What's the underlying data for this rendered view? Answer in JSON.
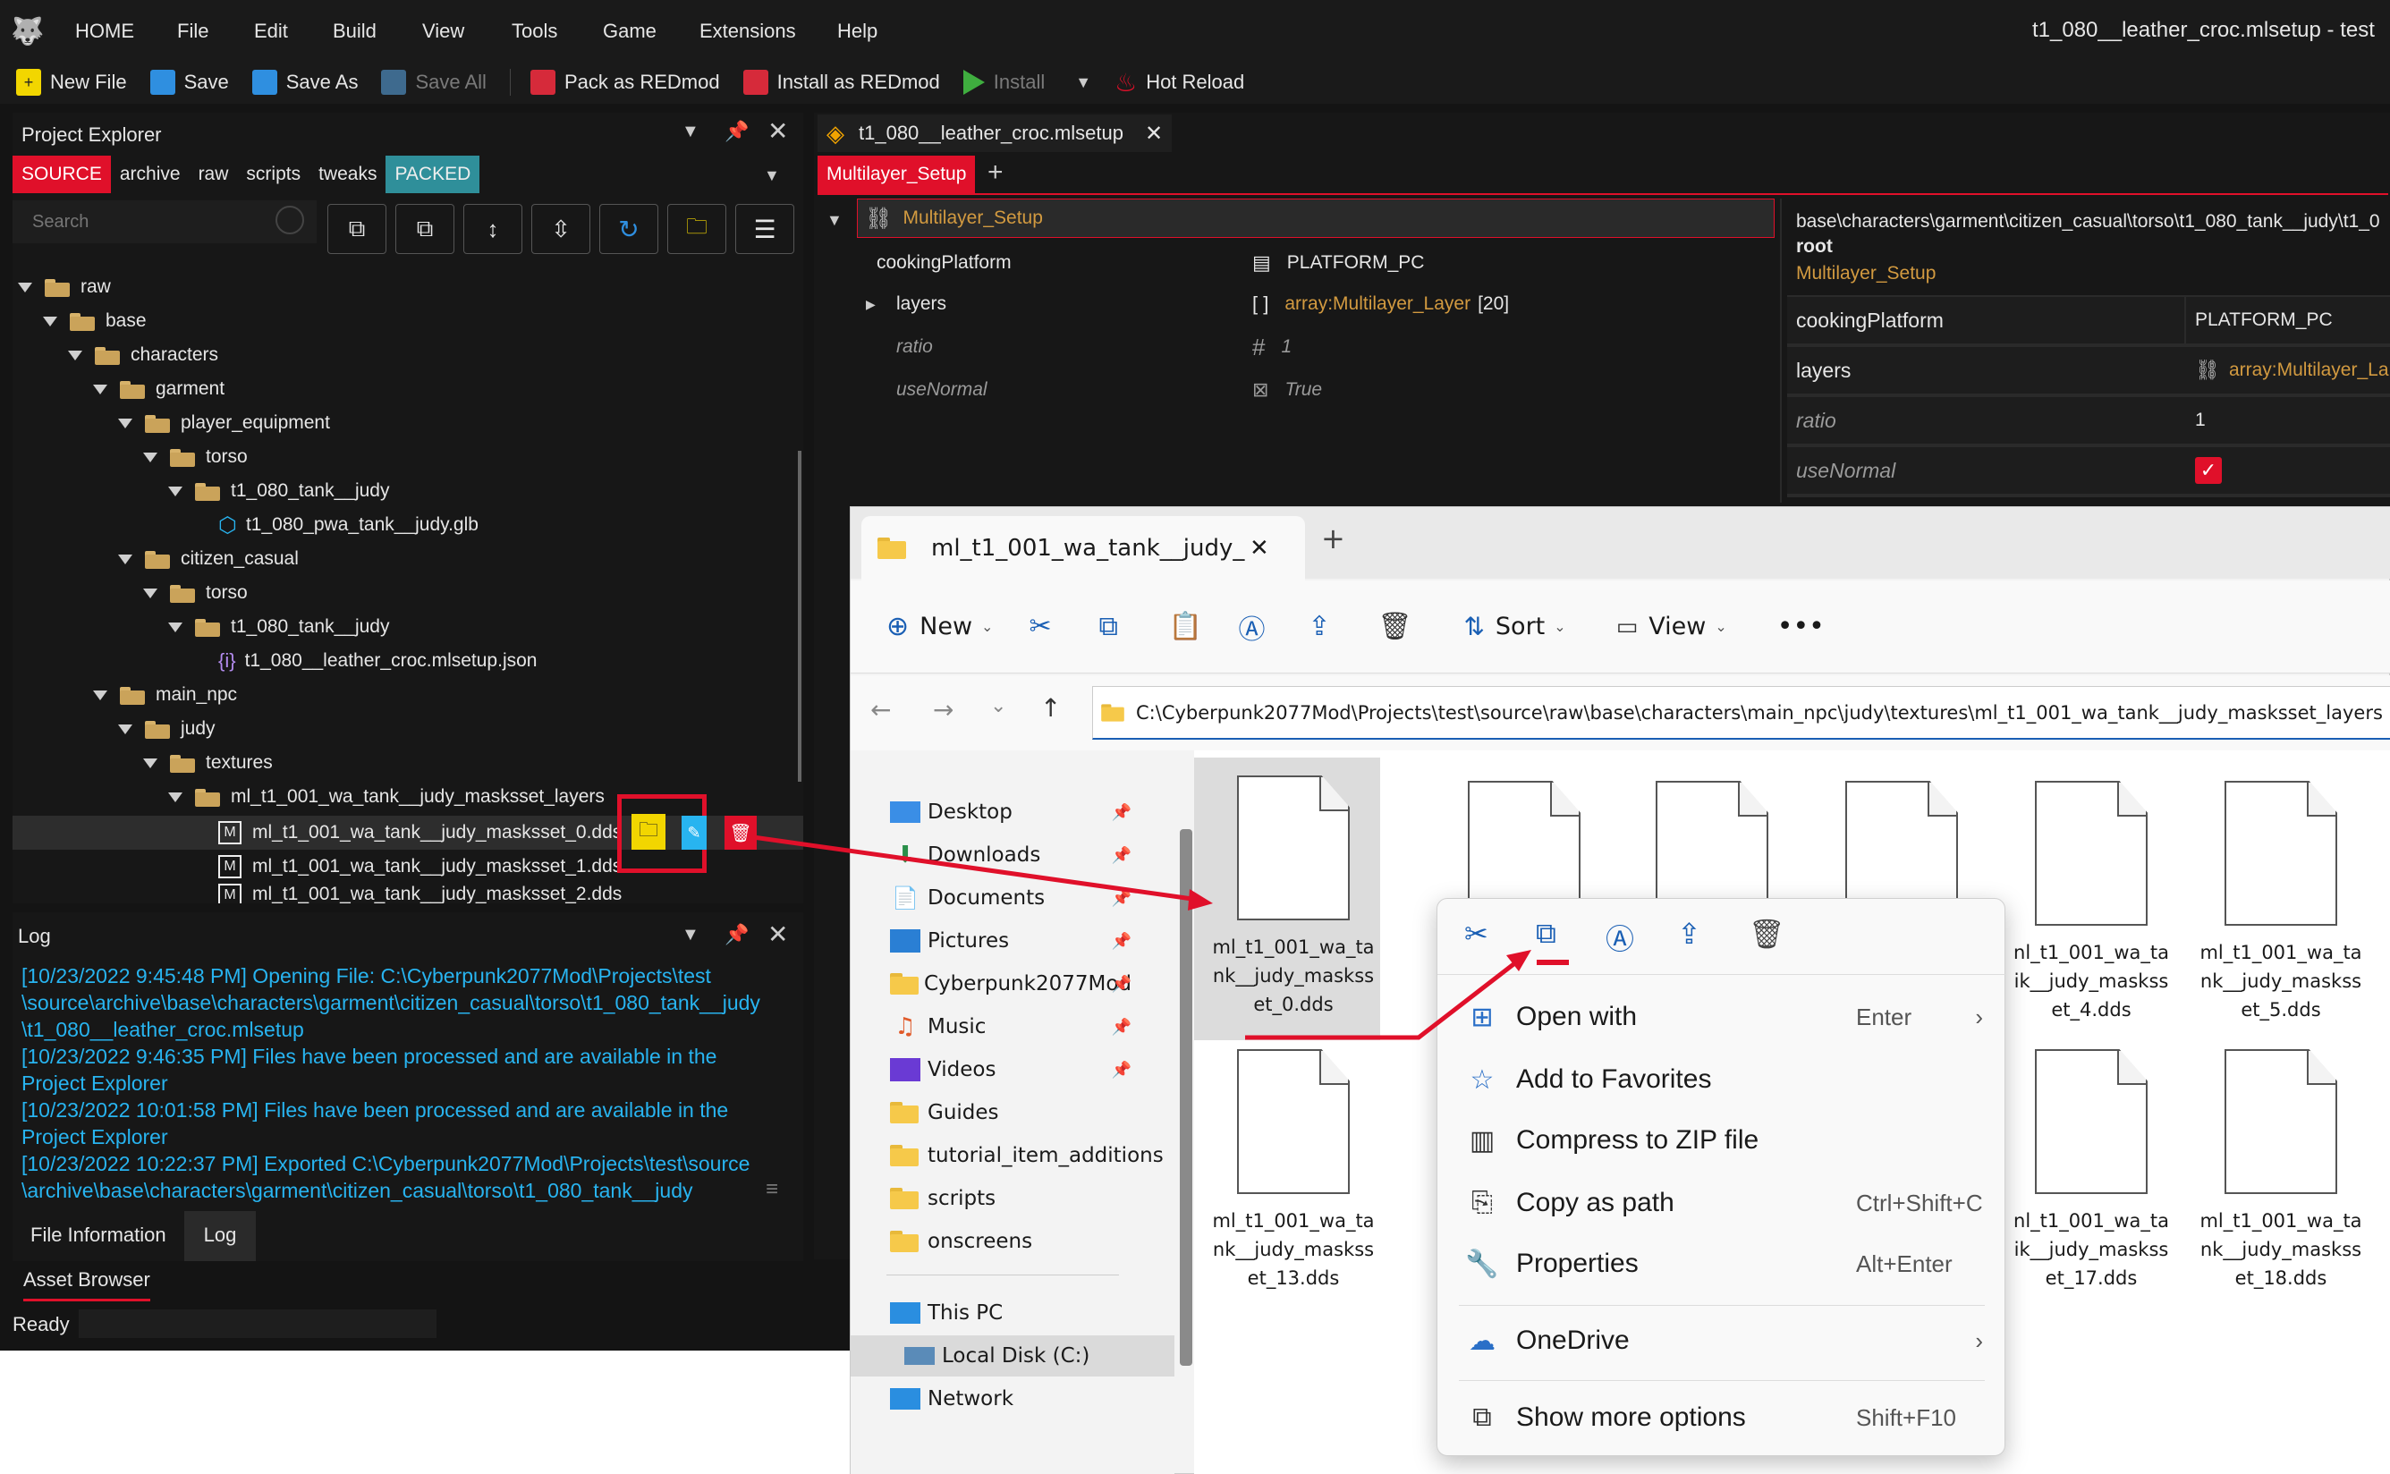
{
  "app": {
    "title": "t1_080__leather_croc.mlsetup - test"
  },
  "menu": [
    "HOME",
    "File",
    "Edit",
    "Build",
    "View",
    "Tools",
    "Game",
    "Extensions",
    "Help"
  ],
  "toolbar": {
    "new_file": "New File",
    "save": "Save",
    "save_as": "Save As",
    "save_all": "Save All",
    "pack": "Pack as REDmod",
    "install_redmod": "Install as REDmod",
    "install": "Install",
    "hot_reload": "Hot Reload"
  },
  "project_explorer": {
    "title": "Project Explorer",
    "tabs": [
      "SOURCE",
      "archive",
      "raw",
      "scripts",
      "tweaks",
      "PACKED"
    ],
    "search_placeholder": "Search",
    "tree": [
      "raw",
      "base",
      "characters",
      "garment",
      "player_equipment",
      "torso",
      "t1_080_tank__judy",
      "t1_080_pwa_tank__judy.glb",
      "citizen_casual",
      "torso",
      "t1_080_tank__judy",
      "t1_080__leather_croc.mlsetup.json",
      "main_npc",
      "judy",
      "textures",
      "ml_t1_001_wa_tank__judy_masksset_layers",
      "ml_t1_001_wa_tank__judy_masksset_0.dds",
      "ml_t1_001_wa_tank__judy_masksset_1.dds",
      "ml_t1_001_wa_tank__judy_masksset_2.dds"
    ]
  },
  "log": {
    "title": "Log",
    "lines": [
      "[10/23/2022 9:45:48 PM] Opening File: C:\\Cyberpunk2077Mod\\Projects\\test",
      "\\source\\archive\\base\\characters\\garment\\citizen_casual\\torso\\t1_080_tank__judy",
      "\\t1_080__leather_croc.mlsetup",
      "[10/23/2022 9:46:35 PM] Files have been processed and are available in the",
      "Project Explorer",
      "[10/23/2022 10:01:58 PM] Files have been processed and are available in the",
      "Project Explorer",
      "[10/23/2022 10:22:37 PM] Exported C:\\Cyberpunk2077Mod\\Projects\\test\\source",
      "\\archive\\base\\characters\\garment\\citizen_casual\\torso\\t1_080_tank__judy"
    ],
    "tabs": [
      "File Information",
      "Log"
    ],
    "asset_browser": "Asset Browser",
    "status": "Ready"
  },
  "editor": {
    "tab": "t1_080__leather_croc.mlsetup",
    "subtab": "Multilayer_Setup",
    "root_node": "Multilayer_Setup",
    "props": [
      {
        "k": "cookingPlatform",
        "v": "PLATFORM_PC"
      },
      {
        "k": "layers",
        "v": "array:Multilayer_Layer",
        "c": "[20]"
      },
      {
        "k": "ratio",
        "v": "1"
      },
      {
        "k": "useNormal",
        "v": "True"
      }
    ],
    "right": {
      "path": "base\\characters\\garment\\citizen_casual\\torso\\t1_080_tank__judy\\t1_0",
      "root": "root",
      "type": "Multilayer_Setup",
      "rows": [
        {
          "k": "cookingPlatform",
          "v": "PLATFORM_PC"
        },
        {
          "k": "layers",
          "v": "array:Multilayer_La"
        },
        {
          "k": "ratio",
          "v": "1"
        },
        {
          "k": "useNormal",
          "v": ""
        }
      ]
    }
  },
  "explorer": {
    "tab_title": "ml_t1_001_wa_tank__judy_",
    "commands": {
      "new": "New",
      "sort": "Sort",
      "view": "View"
    },
    "address": "C:\\Cyberpunk2077Mod\\Projects\\test\\source\\raw\\base\\characters\\main_npc\\judy\\textures\\ml_t1_001_wa_tank__judy_masksset_layers",
    "nav": [
      "Desktop",
      "Downloads",
      "Documents",
      "Pictures",
      "Cyberpunk2077Mod",
      "Music",
      "Videos",
      "Guides",
      "tutorial_item_additions",
      "scripts",
      "onscreens",
      "This PC",
      "Local Disk (C:)",
      "Network"
    ],
    "files": [
      [
        "ml_t1_001_wa_ta",
        "nk__judy_maskss",
        "et_0.dds"
      ],
      [
        "",
        "",
        ""
      ],
      [
        "",
        "",
        ""
      ],
      [
        "",
        "",
        ""
      ],
      [
        "nl_t1_001_wa_ta",
        "ik__judy_maskss",
        "et_4.dds"
      ],
      [
        "ml_t1_001_wa_ta",
        "nk__judy_maskss",
        "et_5.dds"
      ],
      [
        "ml_t1_001_wa_ta",
        "nk__judy_maskss",
        "et_13.dds"
      ],
      [
        "nl_t1_001_wa_ta",
        "ik__judy_maskss",
        "et_17.dds"
      ],
      [
        "ml_t1_001_wa_ta",
        "nk__judy_maskss",
        "et_18.dds"
      ]
    ],
    "context_menu": [
      {
        "label": "Open with",
        "shortcut": "Enter",
        "arrow": true
      },
      {
        "label": "Add to Favorites",
        "shortcut": ""
      },
      {
        "label": "Compress to ZIP file",
        "shortcut": ""
      },
      {
        "label": "Copy as path",
        "shortcut": "Ctrl+Shift+C"
      },
      {
        "label": "Properties",
        "shortcut": "Alt+Enter"
      },
      {
        "label": "OneDrive",
        "shortcut": "",
        "arrow": true
      },
      {
        "label": "Show more options",
        "shortcut": "Shift+F10"
      }
    ]
  },
  "colors": {
    "accent_red": "#e0102a",
    "wk_bg": "#141414",
    "log_text": "#28b4f0",
    "yellow": "#f2d600"
  }
}
